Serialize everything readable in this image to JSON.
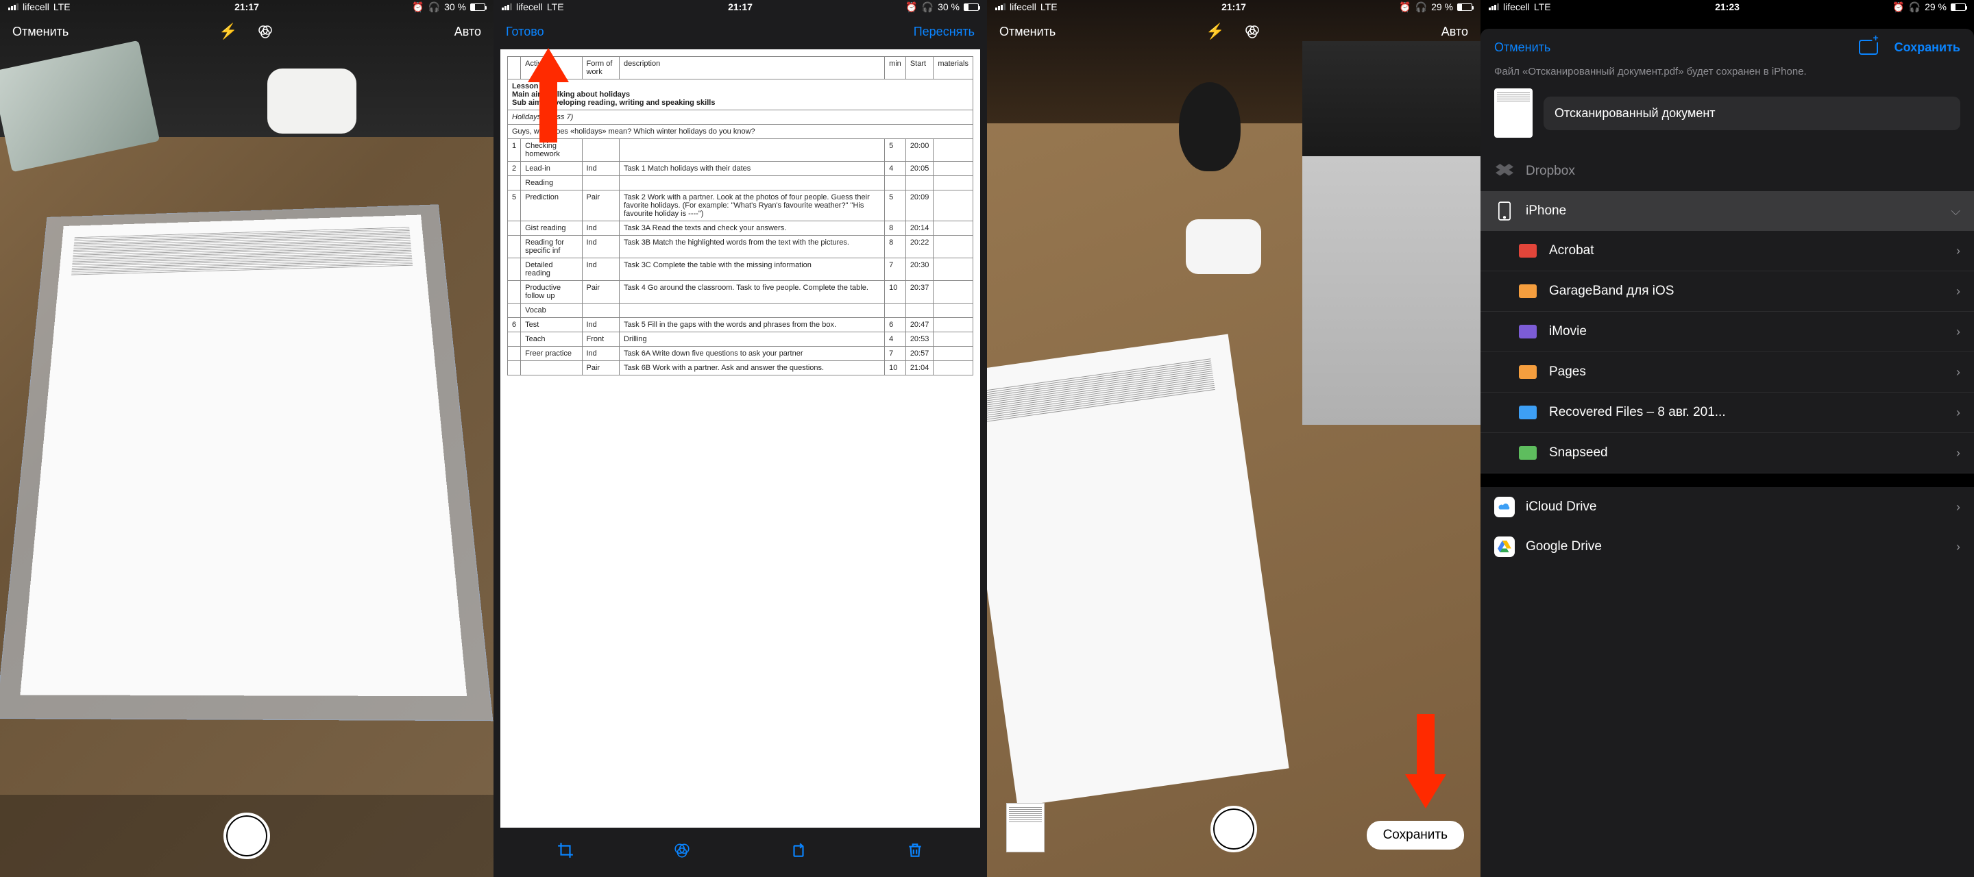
{
  "status": {
    "carrier": "lifecell",
    "network": "LTE",
    "time_1_3": "21:17",
    "time_4": "21:23",
    "battery_1_2": "30 %",
    "battery_3_4": "29 %"
  },
  "screen1": {
    "cancel": "Отменить",
    "auto": "Авто"
  },
  "screen2": {
    "done": "Готово",
    "retake": "Переснять",
    "doc": {
      "lesson": "Lesson 11",
      "main_aim": "Main aim: Talking about holidays",
      "sub_aim": "Sub aim: developing reading, writing and speaking skills",
      "class": "Holidays (Class 7)",
      "guys_line": "Guys, what does «holidays» mean? Which winter holidays do you know?",
      "headers": {
        "n": "",
        "activity": "Activity",
        "form": "Form of work",
        "desc": "description",
        "min": "min",
        "start": "Start",
        "mat": "materials"
      },
      "rows": [
        {
          "n": "1",
          "act": "Checking homework",
          "form": "",
          "desc": "",
          "min": "5",
          "start": "20:00",
          "mat": ""
        },
        {
          "n": "2",
          "act": "Lead-in",
          "form": "Ind",
          "desc": "Task 1 Match holidays with their dates",
          "min": "4",
          "start": "20:05",
          "mat": ""
        },
        {
          "n": "",
          "act": "Reading",
          "form": "",
          "desc": "",
          "min": "",
          "start": "",
          "mat": ""
        },
        {
          "n": "5",
          "act": "Prediction",
          "form": "Pair",
          "desc": "Task 2 Work with a partner. Look at the photos of four people. Guess their favorite holidays. (For example: \"What's Ryan's favourite weather?\" \"His favourite holiday is ----\")",
          "min": "5",
          "start": "20:09",
          "mat": ""
        },
        {
          "n": "",
          "act": "Gist reading",
          "form": "Ind",
          "desc": "Task 3A Read the texts and check your answers.",
          "min": "8",
          "start": "20:14",
          "mat": ""
        },
        {
          "n": "",
          "act": "Reading for specific inf",
          "form": "Ind",
          "desc": "Task 3B Match the highlighted words from the text with the pictures.",
          "min": "8",
          "start": "20:22",
          "mat": ""
        },
        {
          "n": "",
          "act": "Detailed reading",
          "form": "Ind",
          "desc": "Task 3C Complete the table with the missing information",
          "min": "7",
          "start": "20:30",
          "mat": ""
        },
        {
          "n": "",
          "act": "Productive follow up",
          "form": "Pair",
          "desc": "Task 4 Go around the classroom. Task to five people. Complete the table.",
          "min": "10",
          "start": "20:37",
          "mat": ""
        },
        {
          "n": "",
          "act": "Vocab",
          "form": "",
          "desc": "",
          "min": "",
          "start": "",
          "mat": ""
        },
        {
          "n": "6",
          "act": "Test",
          "form": "Ind",
          "desc": "Task 5 Fill in the gaps with the words and phrases from the box.",
          "min": "6",
          "start": "20:47",
          "mat": ""
        },
        {
          "n": "",
          "act": "Teach",
          "form": "Front",
          "desc": "Drilling",
          "min": "4",
          "start": "20:53",
          "mat": ""
        },
        {
          "n": "",
          "act": "Freer practice",
          "form": "Ind",
          "desc": "Task 6A Write down five questions to ask your partner",
          "min": "7",
          "start": "20:57",
          "mat": ""
        },
        {
          "n": "",
          "act": "",
          "form": "Pair",
          "desc": "Task 6B Work with a partner. Ask and answer the questions.",
          "min": "10",
          "start": "21:04",
          "mat": ""
        }
      ]
    }
  },
  "screen3": {
    "cancel": "Отменить",
    "auto": "Авто",
    "save": "Сохранить"
  },
  "screen4": {
    "cancel": "Отменить",
    "save": "Сохранить",
    "info": "Файл «Отсканированный документ.pdf» будет сохранен в iPhone.",
    "doc_name": "Отсканированный документ",
    "dropbox": "Dropbox",
    "iphone": "iPhone",
    "folders": [
      {
        "name": "Acrobat",
        "color": "#e2453a"
      },
      {
        "name": "GarageBand для iOS",
        "color": "#f59e3e"
      },
      {
        "name": "iMovie",
        "color": "#7c5cd6"
      },
      {
        "name": "Pages",
        "color": "#f59e3e"
      },
      {
        "name": "Recovered Files – 8 авг. 201...",
        "color": "#3d9ff5"
      },
      {
        "name": "Snapseed",
        "color": "#5ebd5e"
      }
    ],
    "icloud": "iCloud Drive",
    "gdrive": "Google Drive"
  }
}
